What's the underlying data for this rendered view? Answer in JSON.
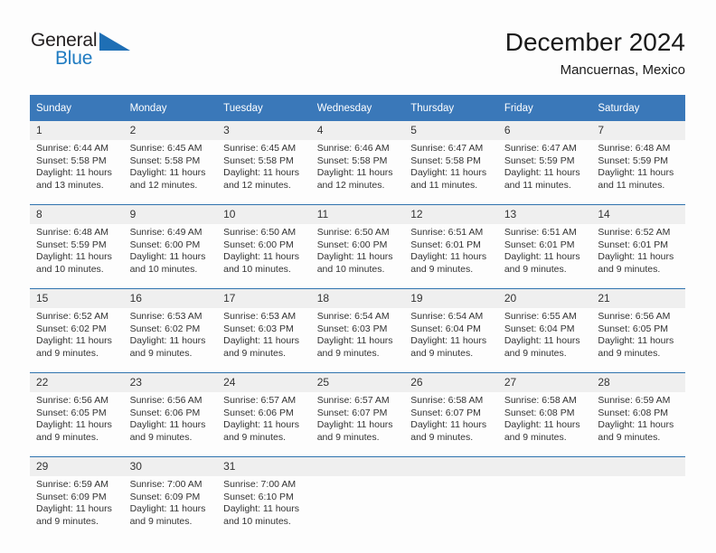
{
  "brand": {
    "name_part1": "General",
    "name_part2": "Blue",
    "flag_icon": "flag-triangle-icon",
    "accent_color": "#1f7bc1"
  },
  "header": {
    "title": "December 2024",
    "subtitle": "Mancuernas, Mexico"
  },
  "theme": {
    "header_blue": "#3a78b9",
    "rule_blue": "#2f73ae",
    "daynum_gray": "#efefef",
    "page_bg": "#fdfdfd"
  },
  "calendar": {
    "weekdays": [
      "Sunday",
      "Monday",
      "Tuesday",
      "Wednesday",
      "Thursday",
      "Friday",
      "Saturday"
    ],
    "weeks": [
      [
        {
          "day": "1",
          "sunrise": "Sunrise: 6:44 AM",
          "sunset": "Sunset: 5:58 PM",
          "daylight_1": "Daylight: 11 hours",
          "daylight_2": "and 13 minutes."
        },
        {
          "day": "2",
          "sunrise": "Sunrise: 6:45 AM",
          "sunset": "Sunset: 5:58 PM",
          "daylight_1": "Daylight: 11 hours",
          "daylight_2": "and 12 minutes."
        },
        {
          "day": "3",
          "sunrise": "Sunrise: 6:45 AM",
          "sunset": "Sunset: 5:58 PM",
          "daylight_1": "Daylight: 11 hours",
          "daylight_2": "and 12 minutes."
        },
        {
          "day": "4",
          "sunrise": "Sunrise: 6:46 AM",
          "sunset": "Sunset: 5:58 PM",
          "daylight_1": "Daylight: 11 hours",
          "daylight_2": "and 12 minutes."
        },
        {
          "day": "5",
          "sunrise": "Sunrise: 6:47 AM",
          "sunset": "Sunset: 5:58 PM",
          "daylight_1": "Daylight: 11 hours",
          "daylight_2": "and 11 minutes."
        },
        {
          "day": "6",
          "sunrise": "Sunrise: 6:47 AM",
          "sunset": "Sunset: 5:59 PM",
          "daylight_1": "Daylight: 11 hours",
          "daylight_2": "and 11 minutes."
        },
        {
          "day": "7",
          "sunrise": "Sunrise: 6:48 AM",
          "sunset": "Sunset: 5:59 PM",
          "daylight_1": "Daylight: 11 hours",
          "daylight_2": "and 11 minutes."
        }
      ],
      [
        {
          "day": "8",
          "sunrise": "Sunrise: 6:48 AM",
          "sunset": "Sunset: 5:59 PM",
          "daylight_1": "Daylight: 11 hours",
          "daylight_2": "and 10 minutes."
        },
        {
          "day": "9",
          "sunrise": "Sunrise: 6:49 AM",
          "sunset": "Sunset: 6:00 PM",
          "daylight_1": "Daylight: 11 hours",
          "daylight_2": "and 10 minutes."
        },
        {
          "day": "10",
          "sunrise": "Sunrise: 6:50 AM",
          "sunset": "Sunset: 6:00 PM",
          "daylight_1": "Daylight: 11 hours",
          "daylight_2": "and 10 minutes."
        },
        {
          "day": "11",
          "sunrise": "Sunrise: 6:50 AM",
          "sunset": "Sunset: 6:00 PM",
          "daylight_1": "Daylight: 11 hours",
          "daylight_2": "and 10 minutes."
        },
        {
          "day": "12",
          "sunrise": "Sunrise: 6:51 AM",
          "sunset": "Sunset: 6:01 PM",
          "daylight_1": "Daylight: 11 hours",
          "daylight_2": "and 9 minutes."
        },
        {
          "day": "13",
          "sunrise": "Sunrise: 6:51 AM",
          "sunset": "Sunset: 6:01 PM",
          "daylight_1": "Daylight: 11 hours",
          "daylight_2": "and 9 minutes."
        },
        {
          "day": "14",
          "sunrise": "Sunrise: 6:52 AM",
          "sunset": "Sunset: 6:01 PM",
          "daylight_1": "Daylight: 11 hours",
          "daylight_2": "and 9 minutes."
        }
      ],
      [
        {
          "day": "15",
          "sunrise": "Sunrise: 6:52 AM",
          "sunset": "Sunset: 6:02 PM",
          "daylight_1": "Daylight: 11 hours",
          "daylight_2": "and 9 minutes."
        },
        {
          "day": "16",
          "sunrise": "Sunrise: 6:53 AM",
          "sunset": "Sunset: 6:02 PM",
          "daylight_1": "Daylight: 11 hours",
          "daylight_2": "and 9 minutes."
        },
        {
          "day": "17",
          "sunrise": "Sunrise: 6:53 AM",
          "sunset": "Sunset: 6:03 PM",
          "daylight_1": "Daylight: 11 hours",
          "daylight_2": "and 9 minutes."
        },
        {
          "day": "18",
          "sunrise": "Sunrise: 6:54 AM",
          "sunset": "Sunset: 6:03 PM",
          "daylight_1": "Daylight: 11 hours",
          "daylight_2": "and 9 minutes."
        },
        {
          "day": "19",
          "sunrise": "Sunrise: 6:54 AM",
          "sunset": "Sunset: 6:04 PM",
          "daylight_1": "Daylight: 11 hours",
          "daylight_2": "and 9 minutes."
        },
        {
          "day": "20",
          "sunrise": "Sunrise: 6:55 AM",
          "sunset": "Sunset: 6:04 PM",
          "daylight_1": "Daylight: 11 hours",
          "daylight_2": "and 9 minutes."
        },
        {
          "day": "21",
          "sunrise": "Sunrise: 6:56 AM",
          "sunset": "Sunset: 6:05 PM",
          "daylight_1": "Daylight: 11 hours",
          "daylight_2": "and 9 minutes."
        }
      ],
      [
        {
          "day": "22",
          "sunrise": "Sunrise: 6:56 AM",
          "sunset": "Sunset: 6:05 PM",
          "daylight_1": "Daylight: 11 hours",
          "daylight_2": "and 9 minutes."
        },
        {
          "day": "23",
          "sunrise": "Sunrise: 6:56 AM",
          "sunset": "Sunset: 6:06 PM",
          "daylight_1": "Daylight: 11 hours",
          "daylight_2": "and 9 minutes."
        },
        {
          "day": "24",
          "sunrise": "Sunrise: 6:57 AM",
          "sunset": "Sunset: 6:06 PM",
          "daylight_1": "Daylight: 11 hours",
          "daylight_2": "and 9 minutes."
        },
        {
          "day": "25",
          "sunrise": "Sunrise: 6:57 AM",
          "sunset": "Sunset: 6:07 PM",
          "daylight_1": "Daylight: 11 hours",
          "daylight_2": "and 9 minutes."
        },
        {
          "day": "26",
          "sunrise": "Sunrise: 6:58 AM",
          "sunset": "Sunset: 6:07 PM",
          "daylight_1": "Daylight: 11 hours",
          "daylight_2": "and 9 minutes."
        },
        {
          "day": "27",
          "sunrise": "Sunrise: 6:58 AM",
          "sunset": "Sunset: 6:08 PM",
          "daylight_1": "Daylight: 11 hours",
          "daylight_2": "and 9 minutes."
        },
        {
          "day": "28",
          "sunrise": "Sunrise: 6:59 AM",
          "sunset": "Sunset: 6:08 PM",
          "daylight_1": "Daylight: 11 hours",
          "daylight_2": "and 9 minutes."
        }
      ],
      [
        {
          "day": "29",
          "sunrise": "Sunrise: 6:59 AM",
          "sunset": "Sunset: 6:09 PM",
          "daylight_1": "Daylight: 11 hours",
          "daylight_2": "and 9 minutes."
        },
        {
          "day": "30",
          "sunrise": "Sunrise: 7:00 AM",
          "sunset": "Sunset: 6:09 PM",
          "daylight_1": "Daylight: 11 hours",
          "daylight_2": "and 9 minutes."
        },
        {
          "day": "31",
          "sunrise": "Sunrise: 7:00 AM",
          "sunset": "Sunset: 6:10 PM",
          "daylight_1": "Daylight: 11 hours",
          "daylight_2": "and 10 minutes."
        },
        {
          "day": "",
          "sunrise": "",
          "sunset": "",
          "daylight_1": "",
          "daylight_2": ""
        },
        {
          "day": "",
          "sunrise": "",
          "sunset": "",
          "daylight_1": "",
          "daylight_2": ""
        },
        {
          "day": "",
          "sunrise": "",
          "sunset": "",
          "daylight_1": "",
          "daylight_2": ""
        },
        {
          "day": "",
          "sunrise": "",
          "sunset": "",
          "daylight_1": "",
          "daylight_2": ""
        }
      ]
    ]
  }
}
